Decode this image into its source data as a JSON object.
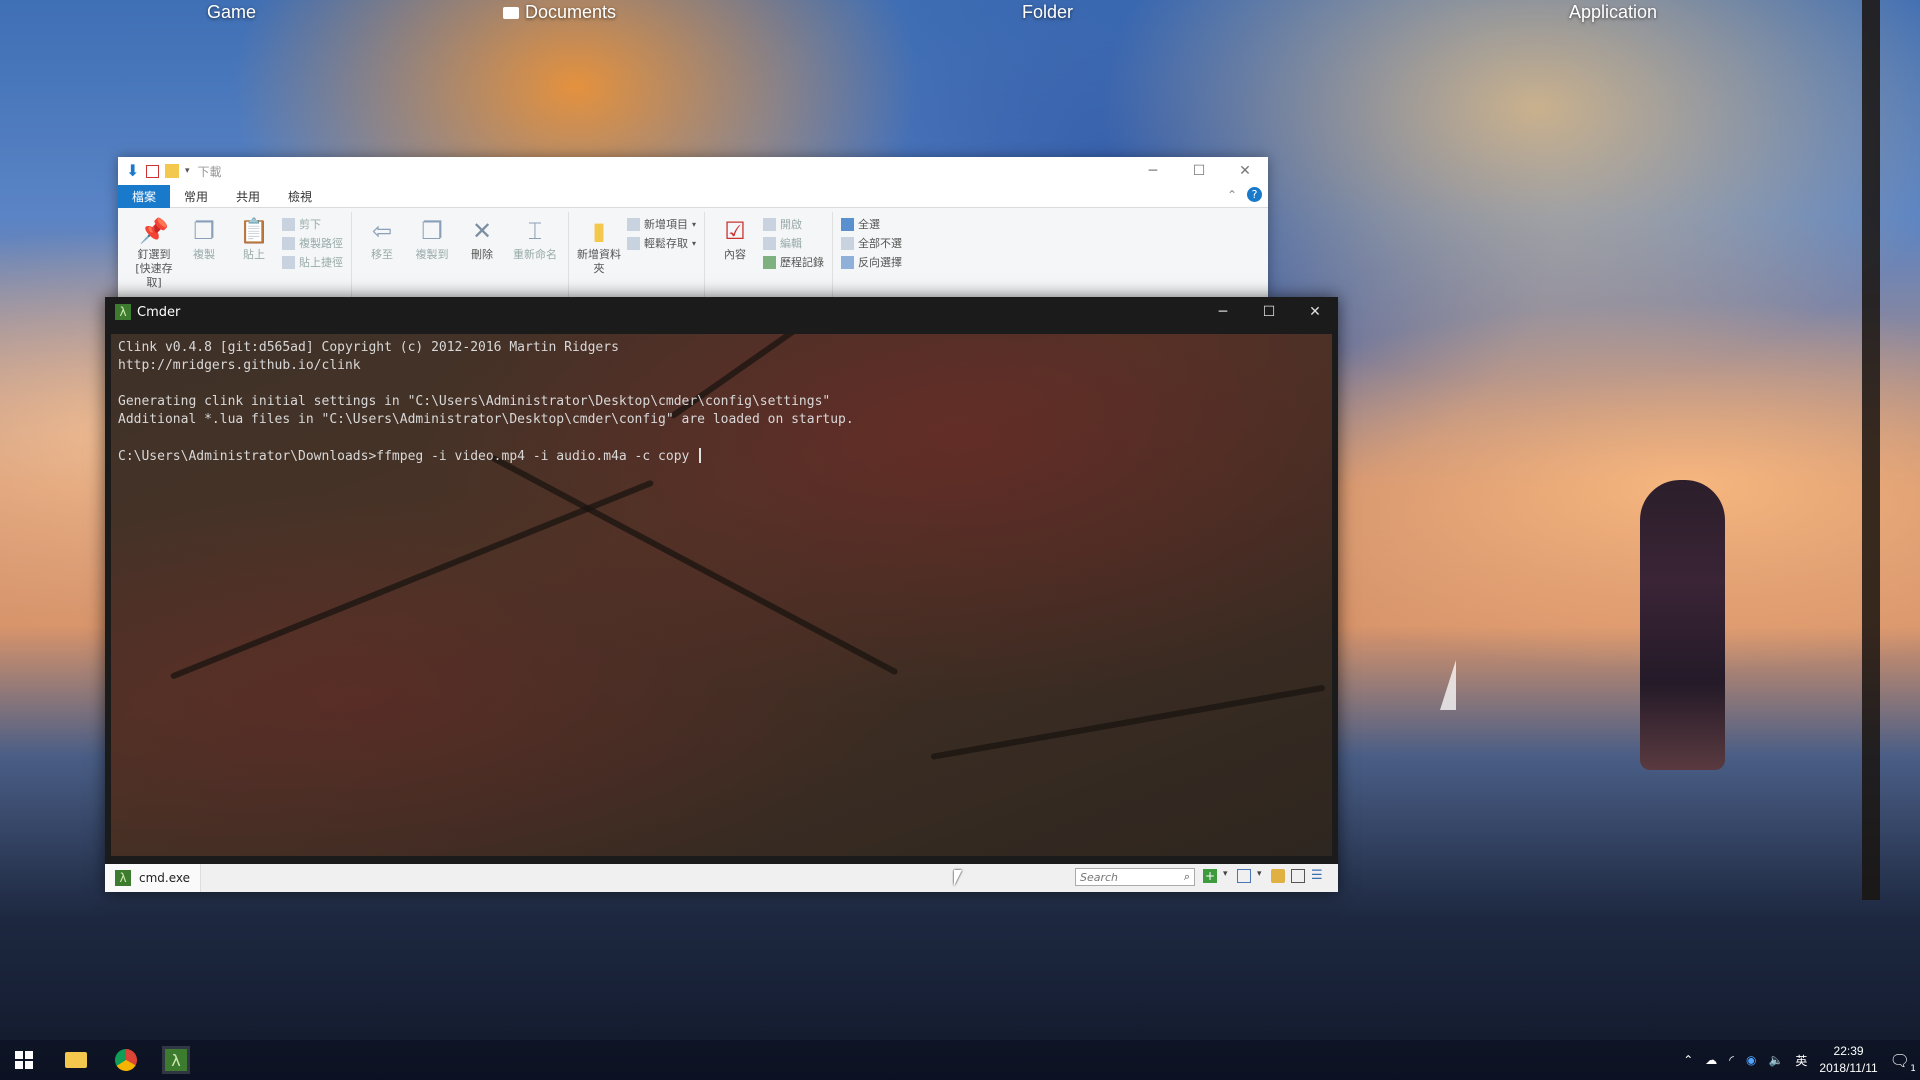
{
  "desktop": {
    "labels": [
      "Game",
      "Documents",
      "Folder",
      "Application"
    ]
  },
  "explorer": {
    "title": "下載",
    "tabs": [
      "檔案",
      "常用",
      "共用",
      "檢視"
    ],
    "ribbon": {
      "pin": "釘選到 [快速存取]",
      "copy": "複製",
      "paste": "貼上",
      "cut": "剪下",
      "copy_path": "複製路徑",
      "paste_shortcut": "貼上捷徑",
      "move_to": "移至",
      "copy_to": "複製到",
      "delete": "刪除",
      "rename": "重新命名",
      "new_folder": "新增資料夾",
      "new_item": "新增項目",
      "easy_access": "輕鬆存取",
      "properties": "內容",
      "open": "開啟",
      "edit": "編輯",
      "history": "歷程記錄",
      "select_all": "全選",
      "select_none": "全部不選",
      "invert_selection": "反向選擇"
    }
  },
  "cmder": {
    "title": "Cmder",
    "console_lines": [
      "Clink v0.4.8 [git:d565ad] Copyright (c) 2012-2016 Martin Ridgers",
      "http://mridgers.github.io/clink",
      "",
      "Generating clink initial settings in \"C:\\Users\\Administrator\\Desktop\\cmder\\config\\settings\"",
      "Additional *.lua files in \"C:\\Users\\Administrator\\Desktop\\cmder\\config\" are loaded on startup.",
      "",
      "C:\\Users\\Administrator\\Downloads>ffmpeg -i video.mp4 -i audio.m4a -c copy "
    ],
    "tab_label": "cmd.exe",
    "search_placeholder": "Search",
    "colors": {
      "accent_green": "#3d7c2f"
    }
  },
  "taskbar": {
    "ime": "英",
    "time": "22:39",
    "date": "2018/11/11",
    "notifications": "1"
  }
}
